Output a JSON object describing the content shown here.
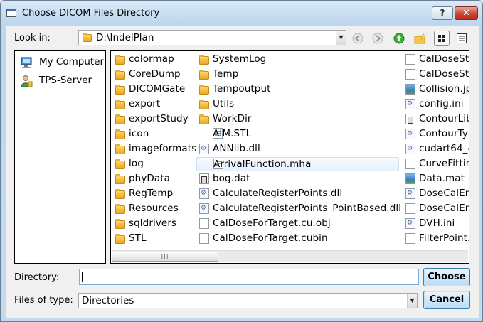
{
  "window": {
    "title": "Choose DICOM Files Directory",
    "help_label": "?",
    "close_label": "✕"
  },
  "lookin": {
    "label": "Look in:",
    "path": "D:\\IndelPlan"
  },
  "sidebar": {
    "items": [
      {
        "label": "My Computer",
        "icon": "computer-icon"
      },
      {
        "label": "TPS-Server",
        "icon": "user-icon"
      }
    ]
  },
  "files": {
    "col1": [
      {
        "name": "colormap",
        "type": "folder"
      },
      {
        "name": "CoreDump",
        "type": "folder"
      },
      {
        "name": "DICOMGate",
        "type": "folder"
      },
      {
        "name": "export",
        "type": "folder"
      },
      {
        "name": "exportStudy",
        "type": "folder"
      },
      {
        "name": "icon",
        "type": "folder"
      },
      {
        "name": "imageformats",
        "type": "folder"
      },
      {
        "name": "log",
        "type": "folder"
      },
      {
        "name": "phyData",
        "type": "folder"
      },
      {
        "name": "RegTemp",
        "type": "folder"
      },
      {
        "name": "Resources",
        "type": "folder"
      },
      {
        "name": "sqldrivers",
        "type": "folder"
      },
      {
        "name": "STL",
        "type": "folder"
      }
    ],
    "col2": [
      {
        "name": "SystemLog",
        "type": "folder"
      },
      {
        "name": "Temp",
        "type": "folder"
      },
      {
        "name": "Tempoutput",
        "type": "folder"
      },
      {
        "name": "Utils",
        "type": "folder"
      },
      {
        "name": "WorkDir",
        "type": "folder"
      },
      {
        "name": "AIM.STL",
        "type": "txt"
      },
      {
        "name": "ANNlib.dll",
        "type": "dll"
      },
      {
        "name": "ArrivalFunction.mha",
        "type": "txt"
      },
      {
        "name": "bog.dat",
        "type": "bin"
      },
      {
        "name": "CalculateRegisterPoints.dll",
        "type": "dll"
      },
      {
        "name": "CalculateRegisterPoints_PointBased.dll",
        "type": "dll"
      },
      {
        "name": "CalDoseForTarget.cu.obj",
        "type": "file"
      },
      {
        "name": "CalDoseForTarget.cubin",
        "type": "file"
      }
    ],
    "col3": [
      {
        "name": "CalDoseStr",
        "type": "file"
      },
      {
        "name": "CalDoseStr",
        "type": "file"
      },
      {
        "name": "Collision.jp",
        "type": "img"
      },
      {
        "name": "config.ini",
        "type": "dll"
      },
      {
        "name": "ContourLib.",
        "type": "bin"
      },
      {
        "name": "ContourTyp",
        "type": "dll"
      },
      {
        "name": "cudart64_4",
        "type": "dll"
      },
      {
        "name": "CurveFitting",
        "type": "file"
      },
      {
        "name": "Data.mat",
        "type": "img"
      },
      {
        "name": "DoseCalEn",
        "type": "dll"
      },
      {
        "name": "DoseCalEn",
        "type": "file"
      },
      {
        "name": "DVH.ini",
        "type": "dll"
      },
      {
        "name": "FilterPoint.",
        "type": "file"
      }
    ],
    "selected": "ArrivalFunction.mha",
    "scroll_grip": "|||"
  },
  "directory": {
    "label": "Directory:",
    "value": "",
    "choose_label": "Choose"
  },
  "filetype": {
    "label": "Files of type:",
    "value": "Directories",
    "cancel_label": "Cancel"
  }
}
